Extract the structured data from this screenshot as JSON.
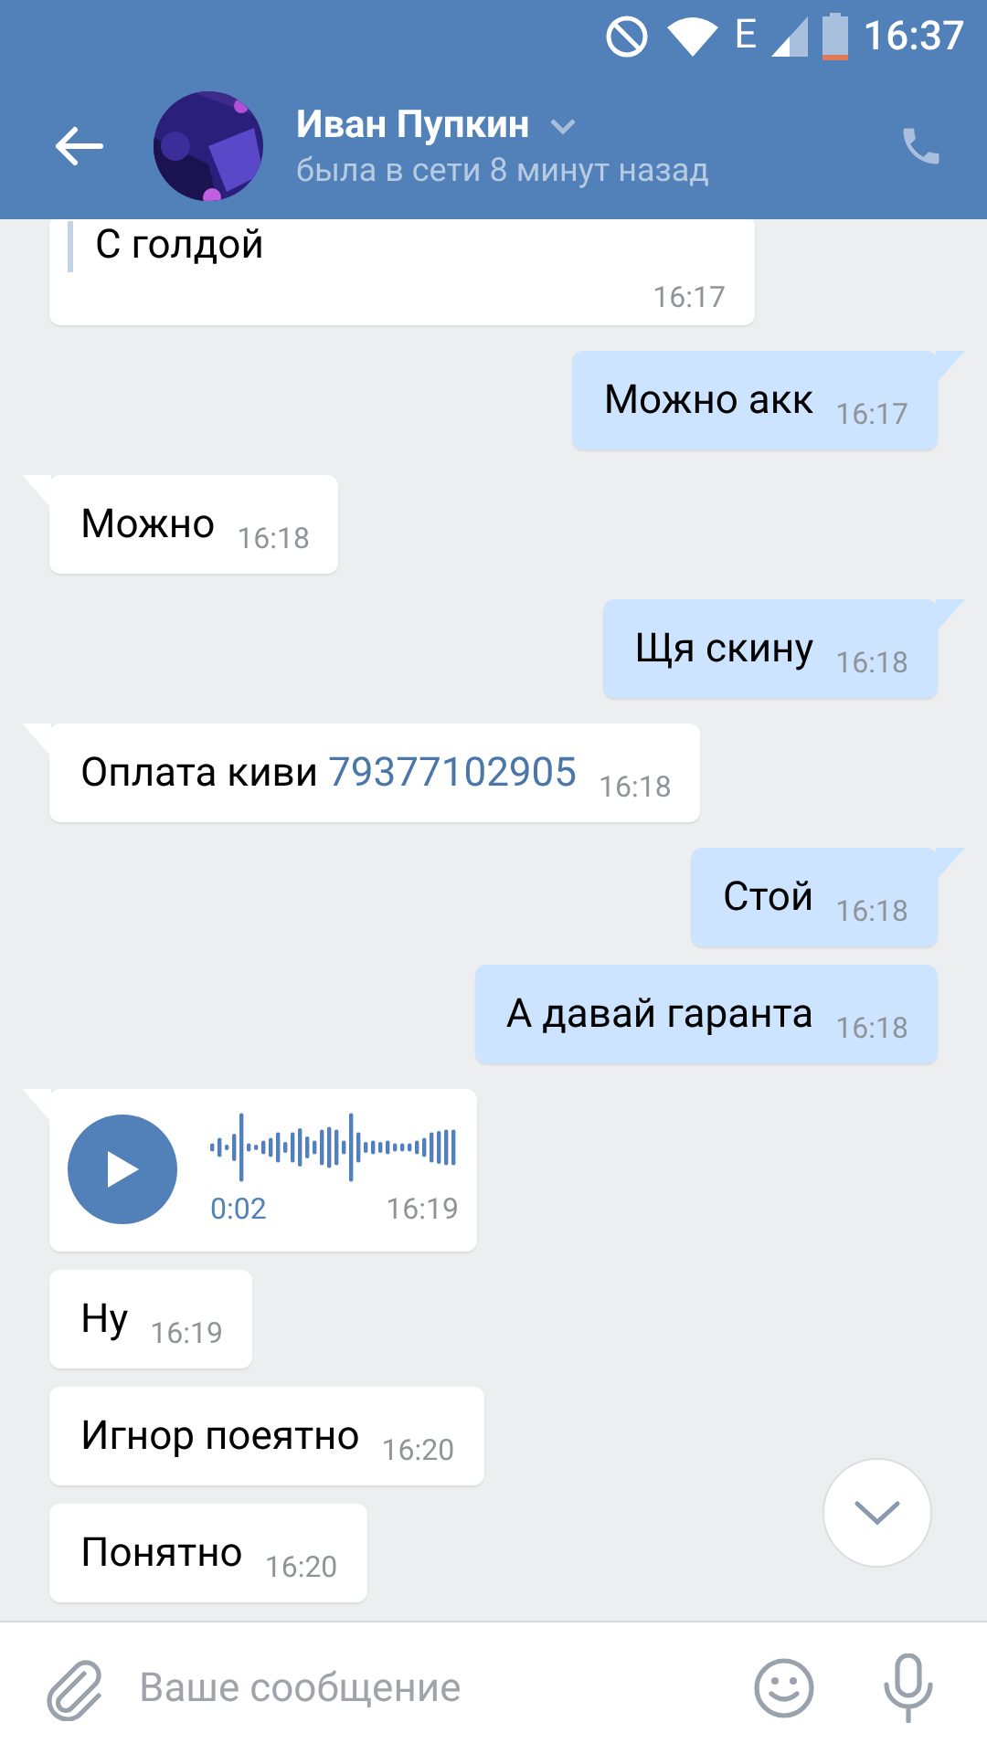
{
  "status_bar": {
    "time": "16:37",
    "network": "E"
  },
  "header": {
    "name": "Иван Пупкин",
    "status": "была в сети 8 минут назад"
  },
  "messages": [
    {
      "kind": "quote",
      "outgoing": false,
      "text": "С голдой",
      "time": "16:17"
    },
    {
      "kind": "text",
      "outgoing": true,
      "text": "Можно акк",
      "time": "16:17"
    },
    {
      "kind": "text",
      "outgoing": false,
      "text": "Можно",
      "time": "16:18"
    },
    {
      "kind": "text",
      "outgoing": true,
      "text": "Щя скину",
      "time": "16:18"
    },
    {
      "kind": "text",
      "outgoing": false,
      "text": "Оплата киви",
      "link": "79377102905",
      "time": "16:18"
    },
    {
      "kind": "text",
      "outgoing": true,
      "text": "Стой",
      "time": "16:18"
    },
    {
      "kind": "text",
      "outgoing": true,
      "text": "А давай гаранта",
      "time": "16:18"
    },
    {
      "kind": "voice",
      "outgoing": false,
      "duration": "0:02",
      "time": "16:19"
    },
    {
      "kind": "text",
      "outgoing": false,
      "text": "Ну",
      "time": "16:19"
    },
    {
      "kind": "text",
      "outgoing": false,
      "text": "Игнор поеятно",
      "time": "16:20"
    },
    {
      "kind": "text",
      "outgoing": false,
      "text": "Понятно",
      "time": "16:20"
    }
  ],
  "composer": {
    "placeholder": "Ваше сообщение"
  }
}
